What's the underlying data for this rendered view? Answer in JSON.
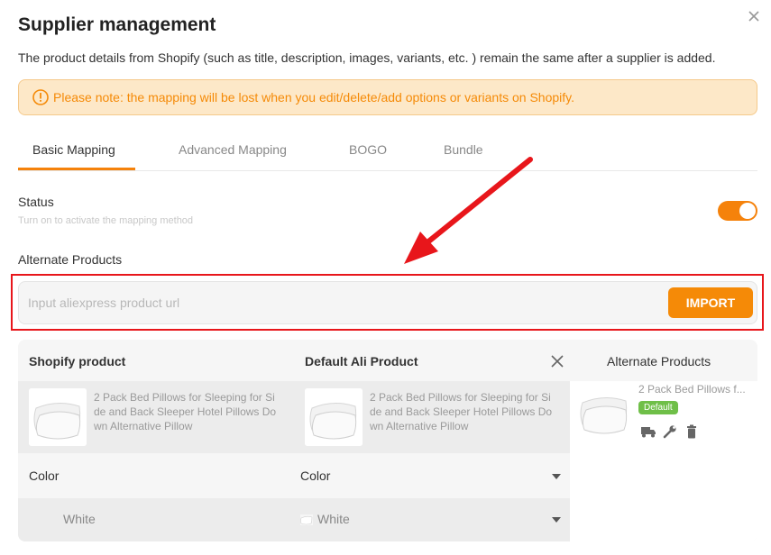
{
  "modal": {
    "title": "Supplier management",
    "subtitle": "The product details from Shopify (such as title, description, images, variants, etc. ) remain the same after a supplier is added.",
    "notice": "Please note: the mapping will be lost when you edit/delete/add options or variants on Shopify."
  },
  "tabs": [
    {
      "label": "Basic Mapping",
      "active": true
    },
    {
      "label": "Advanced Mapping",
      "active": false
    },
    {
      "label": "BOGO",
      "active": false
    },
    {
      "label": "Bundle",
      "active": false
    }
  ],
  "status": {
    "label": "Status",
    "hint": "Turn on to activate the mapping method",
    "enabled": true
  },
  "alternate": {
    "label": "Alternate Products",
    "placeholder": "Input aliexpress product url",
    "import_label": "IMPORT"
  },
  "mapping": {
    "shopify_header": "Shopify product",
    "default_header": "Default Ali Product",
    "alternate_header": "Alternate Products",
    "shopify_product_lines": [
      "2 Pack Bed Pillows for Sleeping for Si",
      "de and Back Sleeper Hotel Pillows Do",
      "wn Alternative Pillow"
    ],
    "default_product_lines": [
      "2 Pack Bed Pillows for Sleeping for Si",
      "de and Back Sleeper Hotel Pillows Do",
      "wn Alternative Pillow"
    ],
    "alternate_product_name": "2 Pack Bed Pillows f...",
    "default_badge": "Default",
    "option_name_left": "Color",
    "option_name_right": "Color",
    "value_left": "White",
    "value_right": "White"
  },
  "icons": [
    "close-icon",
    "warning-circle-icon",
    "truck-icon",
    "wrench-icon",
    "trash-icon",
    "chevron-down-icon",
    "red-arrow-annotation"
  ],
  "colors": {
    "accent": "#f5820b",
    "notice_bg": "#fde8c8",
    "notice_text": "#f58a07",
    "highlight": "#e8161b",
    "badge_green": "#6fbf48"
  }
}
